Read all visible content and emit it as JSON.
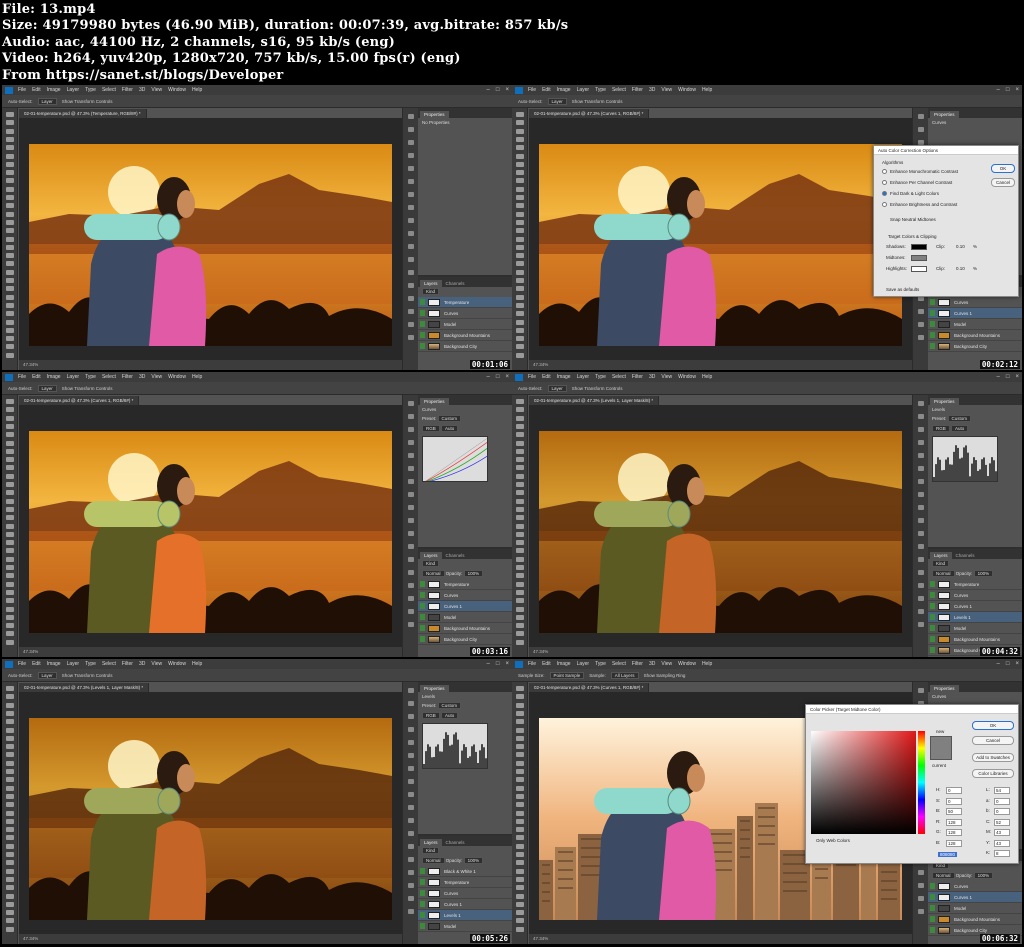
{
  "header": {
    "file": "File: 13.mp4",
    "size": "Size: 49179980 bytes (46.90 MiB), duration: 00:07:39, avg.bitrate: 857 kb/s",
    "audio": "Audio: aac, 44100 Hz, 2 channels, s16, 95 kb/s (eng)",
    "video": "Video: h264, yuv420p, 1280x720, 757 kb/s, 15.00 fps(r) (eng)",
    "from": "From https://sanet.st/blogs/Developer"
  },
  "menu": [
    "File",
    "Edit",
    "Image",
    "Layer",
    "Type",
    "Select",
    "Filter",
    "3D",
    "View",
    "Window",
    "Help"
  ],
  "options": {
    "auto_select": "Auto-Select:",
    "layer": "Layer",
    "show_transform": "Show Transform Controls",
    "sample_size_label": "Sample Size:",
    "sample_size": "Point Sample",
    "sample_label": "Sample:",
    "sample": "All Layers",
    "show_ring": "Show Sampling Ring"
  },
  "common": {
    "properties": "Properties",
    "layers": "Layers",
    "channels": "Channels",
    "zoom": "47.34%",
    "curves": "Curves",
    "levels": "Levels",
    "preset": "Preset:",
    "custom": "Custom",
    "rgb": "RGB",
    "auto": "Auto",
    "normal": "Normal",
    "opacity": "Opacity:",
    "fill": "Fill:",
    "hundred": "100%",
    "kind": "Kind"
  },
  "frames": [
    {
      "tab": "02-01-temperature.psd @ 47.3% (Temperature, RGB/8#) *",
      "panel_title": "Properties",
      "panel_sub": "No Properties",
      "layers": [
        "Temperature",
        "Curves",
        "Model",
        "Background Mountains",
        "Background City"
      ],
      "selected": 0,
      "time": "00:01:06"
    },
    {
      "tab": "02-01-temperature.psd @ 47.3% (Curves 1, RGB/8#) *",
      "panel_title": "Properties",
      "panel_sub": "Curves",
      "layers": [
        "Curves",
        "Curves 1",
        "Model",
        "Background Mountains",
        "Background City"
      ],
      "selected": 1,
      "time": "00:02:12"
    },
    {
      "tab": "02-01-temperature.psd @ 47.3% (Curves 1, RGB/8#) *",
      "panel_title": "Properties",
      "panel_sub": "Curves",
      "layers": [
        "Temperature",
        "Curves",
        "Curves 1",
        "Model",
        "Background Mountains",
        "Background City"
      ],
      "selected": 2,
      "time": "00:03:16"
    },
    {
      "tab": "02-01-temperature.psd @ 47.3% (Levels 1, Layer Mask/8) *",
      "panel_title": "Properties",
      "panel_sub": "Levels",
      "layers": [
        "Temperature",
        "Curves",
        "Curves 1",
        "Levels 1",
        "Model",
        "Background Mountains",
        "Background City"
      ],
      "selected": 3,
      "time": "00:04:32"
    },
    {
      "tab": "02-01-temperature.psd @ 47.3% (Levels 1, Layer Mask/8) *",
      "panel_title": "Properties",
      "panel_sub": "Levels",
      "layers": [
        "Black & White 1",
        "Temperature",
        "Curves",
        "Curves 1",
        "Levels 1",
        "Model"
      ],
      "selected": 4,
      "time": "00:05:26"
    },
    {
      "tab": "02-01-temperature.psd @ 47.3% (Curves 1, RGB/8#) *",
      "panel_title": "Properties",
      "panel_sub": "Curves",
      "layers": [
        "Curves",
        "Curves 1",
        "Model",
        "Background Mountains",
        "Background City"
      ],
      "selected": 1,
      "time": "00:06:32"
    }
  ],
  "auto_color": {
    "title": "Auto Color Correction Options",
    "algorithms": "Algorithms",
    "opt1": "Enhance Monochromatic Contrast",
    "opt2": "Enhance Per Channel Contrast",
    "opt3": "Find Dark & Light Colors",
    "opt4": "Enhance Brightness and Contrast",
    "snap": "Snap Neutral Midtones",
    "target": "Target Colors & Clipping",
    "shadows": "Shadows:",
    "midtones": "Midtones:",
    "highlights": "Highlights:",
    "clip": "Clip:",
    "clip_val": "0.10",
    "pct": "%",
    "save": "Save as defaults",
    "ok": "OK",
    "cancel": "Cancel"
  },
  "color_picker": {
    "title": "Color Picker (Target Midtone Color)",
    "ok": "OK",
    "cancel": "Cancel",
    "add_swatches": "Add to Swatches",
    "libraries": "Color Libraries",
    "new_label": "new",
    "current_label": "current",
    "only_web": "Only Web Colors",
    "h": "H:",
    "h_val": "0",
    "s": "S:",
    "s_val": "0",
    "b": "B:",
    "b_val": "50",
    "r": "R:",
    "r_val": "128",
    "g": "G:",
    "g_val": "128",
    "bb": "B:",
    "bb_val": "128",
    "l": "L:",
    "l_val": "54",
    "a": "a:",
    "a_val": "0",
    "b2": "b:",
    "b2_val": "0",
    "c": "C:",
    "c_val": "52",
    "m": "M:",
    "m_val": "43",
    "y": "Y:",
    "y_val": "43",
    "k": "K:",
    "k_val": "8",
    "hex": "808080"
  }
}
